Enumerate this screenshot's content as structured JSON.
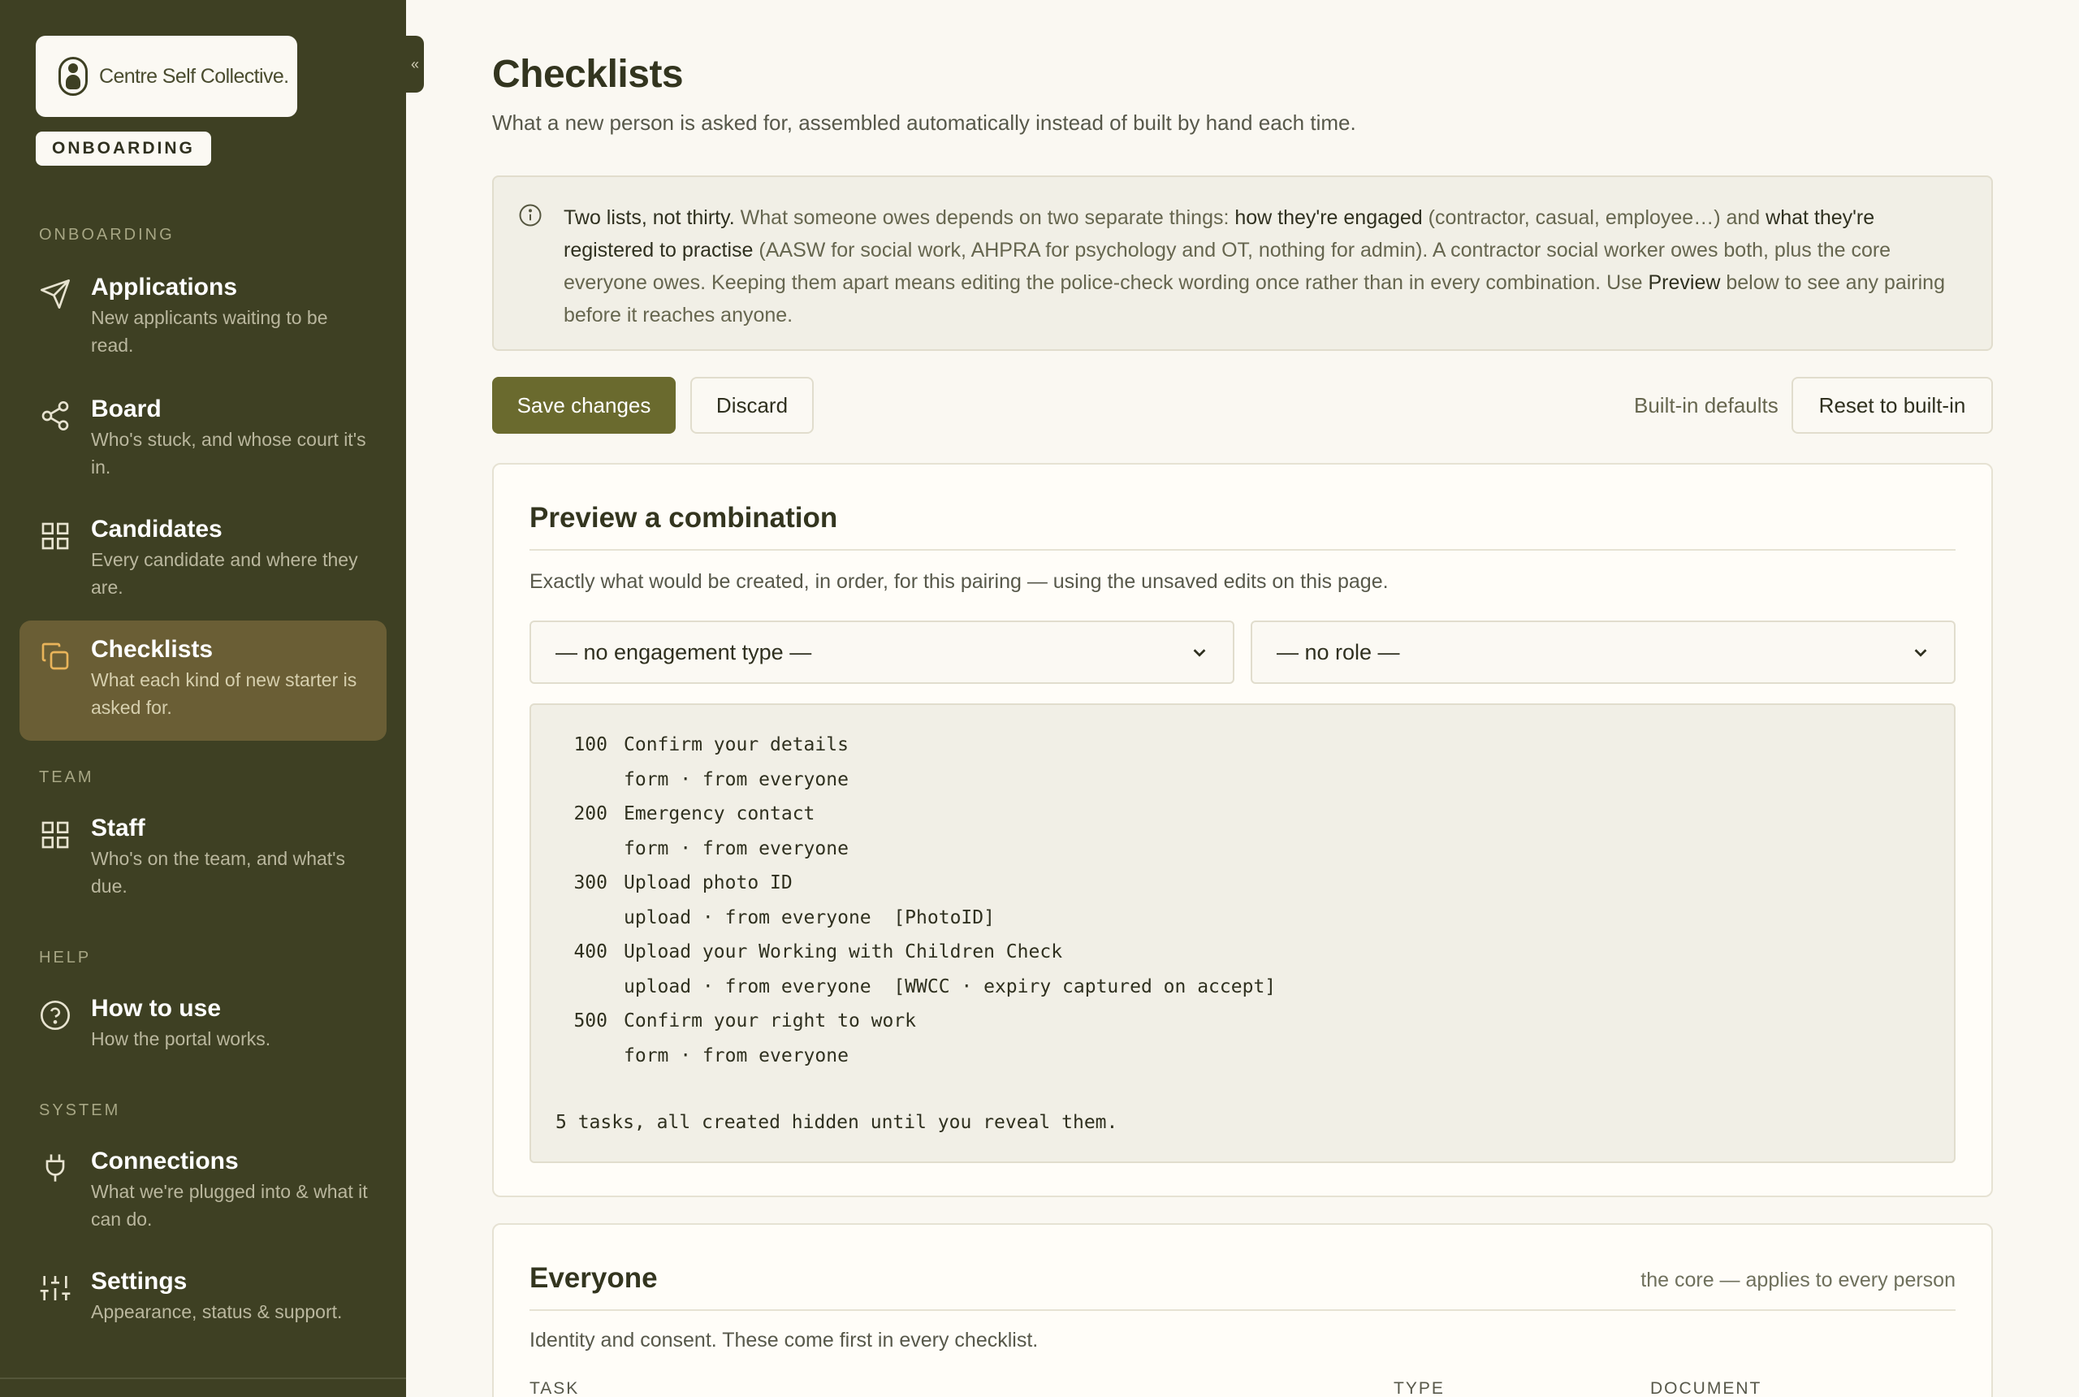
{
  "sidebar": {
    "brand_name": "Centre Self Collective.",
    "badge": "ONBOARDING",
    "sections": {
      "onboarding": "ONBOARDING",
      "team": "TEAM",
      "help": "HELP",
      "system": "SYSTEM"
    },
    "items": [
      {
        "title": "Applications",
        "desc": "New applicants waiting to be read.",
        "icon": "send-icon"
      },
      {
        "title": "Board",
        "desc": "Who's stuck, and whose court it's in.",
        "icon": "share-icon"
      },
      {
        "title": "Candidates",
        "desc": "Every candidate and where they are.",
        "icon": "grid-icon"
      },
      {
        "title": "Checklists",
        "desc": "What each kind of new starter is asked for.",
        "icon": "copy-icon",
        "active": true
      },
      {
        "title": "Staff",
        "desc": "Who's on the team, and what's due.",
        "icon": "grid-icon"
      },
      {
        "title": "How to use",
        "desc": "How the portal works.",
        "icon": "help-circle-icon"
      },
      {
        "title": "Connections",
        "desc": "What we're plugged into & what it can do.",
        "icon": "plug-icon"
      },
      {
        "title": "Settings",
        "desc": "Appearance, status & support.",
        "icon": "sliders-icon"
      }
    ],
    "collapse_glyph": "«"
  },
  "page": {
    "title": "Checklists",
    "subtitle": "What a new person is asked for, assembled automatically instead of built by hand each time."
  },
  "info": {
    "lead": "Two lists, not thirty.",
    "t1": " What someone owes depends on two separate things: ",
    "e1": "how they're engaged",
    "t2": " (contractor, casual, employee…) and ",
    "e2": "what they're registered to practise",
    "t3": " (AASW for social work, AHPRA for psychology and OT, nothing for admin). A contractor social worker owes both, plus the core everyone owes. Keeping them apart means editing the police-check wording once rather than in every combination. Use ",
    "e3": "Preview",
    "t4": " below to see any pairing before it reaches anyone."
  },
  "actions": {
    "save": "Save changes",
    "discard": "Discard",
    "builtin_label": "Built-in defaults",
    "reset": "Reset to built-in"
  },
  "preview": {
    "title": "Preview a combination",
    "desc": "Exactly what would be created, in order, for this pairing — using the unsaved edits on this page.",
    "engagement_select": "— no engagement type —",
    "role_select": "— no role —",
    "lines": [
      {
        "num": "100",
        "text": "Confirm your details"
      },
      {
        "num": "",
        "text": "form · from everyone"
      },
      {
        "num": "200",
        "text": "Emergency contact"
      },
      {
        "num": "",
        "text": "form · from everyone"
      },
      {
        "num": "300",
        "text": "Upload photo ID"
      },
      {
        "num": "",
        "text": "upload · from everyone  [PhotoID]"
      },
      {
        "num": "400",
        "text": "Upload your Working with Children Check"
      },
      {
        "num": "",
        "text": "upload · from everyone  [WWCC · expiry captured on accept]"
      },
      {
        "num": "500",
        "text": "Confirm your right to work"
      },
      {
        "num": "",
        "text": "form · from everyone"
      }
    ],
    "summary": "5 tasks, all created hidden until you reveal them."
  },
  "everyone": {
    "title": "Everyone",
    "aside": "the core — applies to every person",
    "desc": "Identity and consent. These come first in every checklist.",
    "columns": [
      "TASK",
      "TYPE",
      "DOCUMENT"
    ]
  }
}
